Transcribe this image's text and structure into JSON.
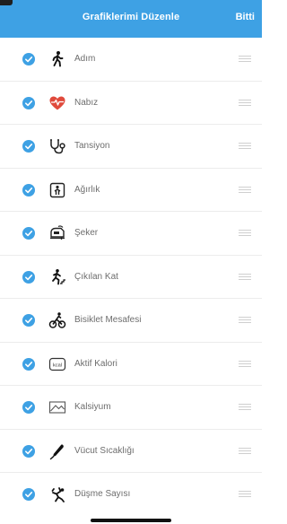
{
  "header": {
    "title": "Grafiklerimi Düzenle",
    "done_label": "Bitti"
  },
  "items": [
    {
      "label": "Adım",
      "icon": "walking-person-icon",
      "checked": true
    },
    {
      "label": "Nabız",
      "icon": "heart-pulse-icon",
      "checked": true
    },
    {
      "label": "Tansiyon",
      "icon": "stethoscope-icon",
      "checked": true
    },
    {
      "label": "Ağırlık",
      "icon": "weight-scale-icon",
      "checked": true
    },
    {
      "label": "Şeker",
      "icon": "glucose-meter-icon",
      "checked": true
    },
    {
      "label": "Çıkılan Kat",
      "icon": "stairs-climb-icon",
      "checked": true
    },
    {
      "label": "Bisiklet Mesafesi",
      "icon": "bicycle-icon",
      "checked": true
    },
    {
      "label": "Aktif Kalori",
      "icon": "kcal-icon",
      "checked": true
    },
    {
      "label": "Kalsiyum",
      "icon": "chart-icon",
      "checked": true
    },
    {
      "label": "Vücut Sıcaklığı",
      "icon": "thermometer-icon",
      "checked": true
    },
    {
      "label": "Düşme Sayısı",
      "icon": "fall-icon",
      "checked": true
    }
  ],
  "colors": {
    "accent": "#3ea1e4",
    "heart": "#e04a3c"
  },
  "icon_glyphs": {
    "kcal": "kcal"
  }
}
